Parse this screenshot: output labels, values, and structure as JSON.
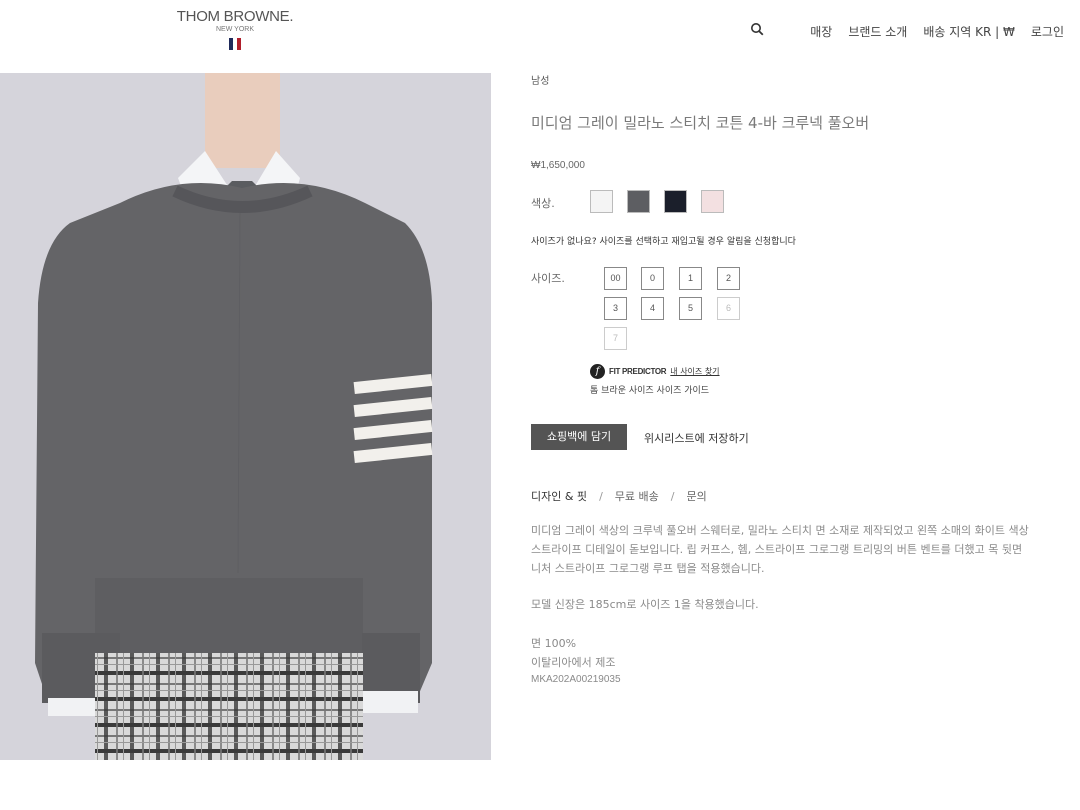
{
  "header": {
    "logo_main": "THOM BROWNE.",
    "logo_sub": "NEW YORK",
    "flag_colors": [
      "#1f2a5a",
      "#ffffff",
      "#b01e2b"
    ],
    "search_icon": "search-icon",
    "nav": [
      "매장",
      "브랜드 소개",
      "배송 지역 KR | ₩",
      "로그인"
    ]
  },
  "product": {
    "breadcrumb": "남성",
    "title": "미디엄 그레이 밀라노 스티치 코튼 4-바 크루넥 풀오버",
    "price": "₩1,650,000",
    "color_label": "색상.",
    "colors": [
      "#f4f4f4",
      "#5d5e62",
      "#1b1f2b",
      "#f3e0e1"
    ],
    "size_note": "사이즈가 없나요? 사이즈를 선택하고 재입고될 경우 알림을 신청합니다",
    "size_label": "사이즈.",
    "sizes": [
      "00",
      "0",
      "1",
      "2",
      "3",
      "4",
      "5",
      "6",
      "7"
    ],
    "unavailable_sizes": [
      "6",
      "7"
    ],
    "fit_icon": "f",
    "fit_name": "FIT PREDICTOR",
    "fit_link": "내 사이즈 찾기",
    "size_guide": "톰 브라운 사이즈 사이즈 가이드",
    "add_to_bag": "쇼핑백에 담기",
    "wishlist": "위시리스트에 저장하기",
    "tabs": [
      "디자인 & 핏",
      "무료 배송",
      "문의"
    ],
    "desc_lines": [
      "미디엄 그레이 색상의 크루넥 풀오버 스웨터로, 밀라노 스티치 면 소재로 제작되었고 왼쪽 소매의 화이트 색상",
      "스트라이프 디테일이 돋보입니다. 립 커프스, 헴, 스트라이프 그로그랭 트리밍의 버튼 벤트를 더했고 목 뒷면",
      "니처 스트라이프 그로그랭 루프 탭을 적용했습니다."
    ],
    "model_info": "모델 신장은 185cm로 사이즈 1을 착용했습니다.",
    "material": "면 100%",
    "origin": "이탈리아에서 제조",
    "sku": "MKA202A00219035"
  }
}
